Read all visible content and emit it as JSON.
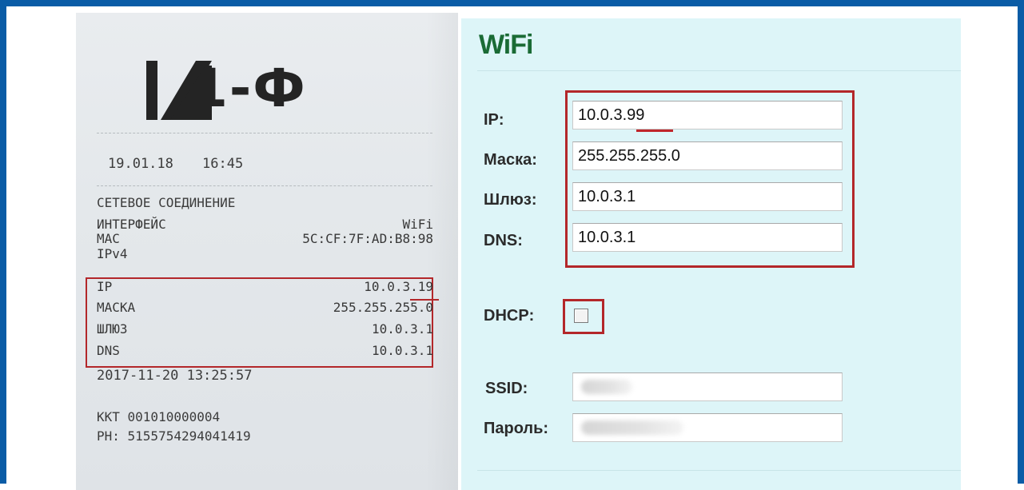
{
  "receipt": {
    "logo": "К1-Ф",
    "date": "19.01.18",
    "time": "16:45",
    "section_title": "СЕТЕВОЕ СОЕДИНЕНИЕ",
    "rows": [
      {
        "label": "ИНТЕРФЕЙС",
        "value": "WiFi"
      },
      {
        "label": "MAC",
        "value": "5C:CF:7F:AD:B8:98"
      },
      {
        "label": "IPv4",
        "value": ""
      },
      {
        "label": "IP",
        "value": "10.0.3.19"
      },
      {
        "label": "MACKA",
        "value": "255.255.255.0"
      },
      {
        "label": "ШЛЮЗ",
        "value": "10.0.3.1"
      },
      {
        "label": "DNS",
        "value": "10.0.3.1"
      }
    ],
    "timestamp": "2017-11-20 13:25:57",
    "kkt": "ККТ 001010000004",
    "rn": "PH: 5155754294041419"
  },
  "wifi_panel": {
    "title": "WiFi",
    "fields": {
      "ip": {
        "label": "IP:",
        "value": "10.0.3.99"
      },
      "mask": {
        "label": "Маска:",
        "value": "255.255.255.0"
      },
      "gateway": {
        "label": "Шлюз:",
        "value": "10.0.3.1"
      },
      "dns": {
        "label": "DNS:",
        "value": "10.0.3.1"
      }
    },
    "dhcp": {
      "label": "DHCP:",
      "checked": false
    },
    "ssid": {
      "label": "SSID:",
      "value": ""
    },
    "password": {
      "label": "Пароль:",
      "value": ""
    }
  },
  "colors": {
    "frame": "#0a5ca6",
    "panel_bg": "#ddf5f8",
    "title": "#1a6b35",
    "highlight": "#b3272a"
  }
}
